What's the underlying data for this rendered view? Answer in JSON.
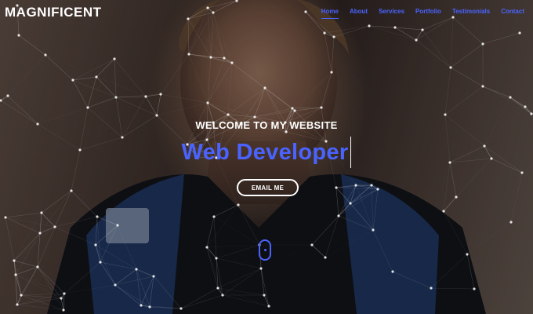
{
  "brand": {
    "name": "MAGNIFICENT"
  },
  "nav": {
    "items": [
      {
        "label": "Home",
        "active": true
      },
      {
        "label": "About"
      },
      {
        "label": "Services"
      },
      {
        "label": "Portfolio"
      },
      {
        "label": "Testimonials"
      },
      {
        "label": "Contact"
      }
    ]
  },
  "hero": {
    "welcome": "WELCOME TO MY WEBSITE",
    "typed_text": "Web Developer",
    "cta_label": "EMAIL ME"
  },
  "colors": {
    "accent": "#4a63ff",
    "text": "#ffffff"
  }
}
